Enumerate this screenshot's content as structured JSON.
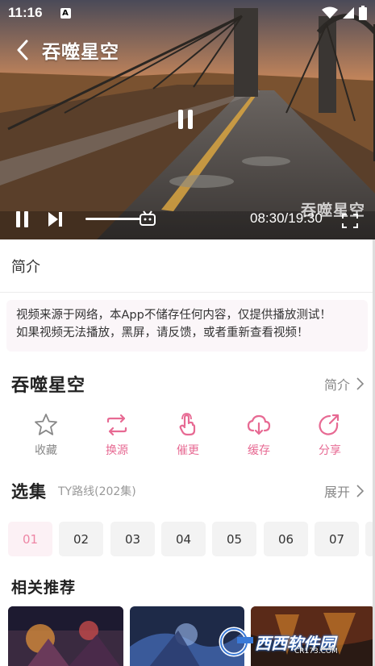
{
  "status_bar": {
    "time": "11:16",
    "notification_icon": "A"
  },
  "video": {
    "title": "吞噬星空",
    "watermark": "吞噬星空",
    "time_display": "08:30/19:30"
  },
  "intro_tab": {
    "label": "简介"
  },
  "notice": {
    "line1": "视频来源于网络，本App不储存任何内容，仅提供播放测试！",
    "line2": "如果视频无法播放，黑屏，请反馈，或者重新查看视频！"
  },
  "show": {
    "title": "吞噬星空",
    "intro_label": "简介"
  },
  "actions": [
    {
      "label": "收藏",
      "icon": "star-icon"
    },
    {
      "label": "换源",
      "icon": "switch-icon"
    },
    {
      "label": "催更",
      "icon": "hand-icon"
    },
    {
      "label": "缓存",
      "icon": "cloud-download-icon"
    },
    {
      "label": "分享",
      "icon": "share-icon"
    }
  ],
  "episodes": {
    "title": "选集",
    "route": "TY路线(202集)",
    "more_label": "展开",
    "items": [
      "01",
      "02",
      "03",
      "04",
      "05",
      "06",
      "07"
    ],
    "selected": "01"
  },
  "recommend": {
    "title": "相关推荐"
  },
  "site_watermark": {
    "text": "西西软件园",
    "url": "CR173.COM"
  },
  "colors": {
    "accent": "#e76a93",
    "active_episode": "#ee86a5"
  }
}
